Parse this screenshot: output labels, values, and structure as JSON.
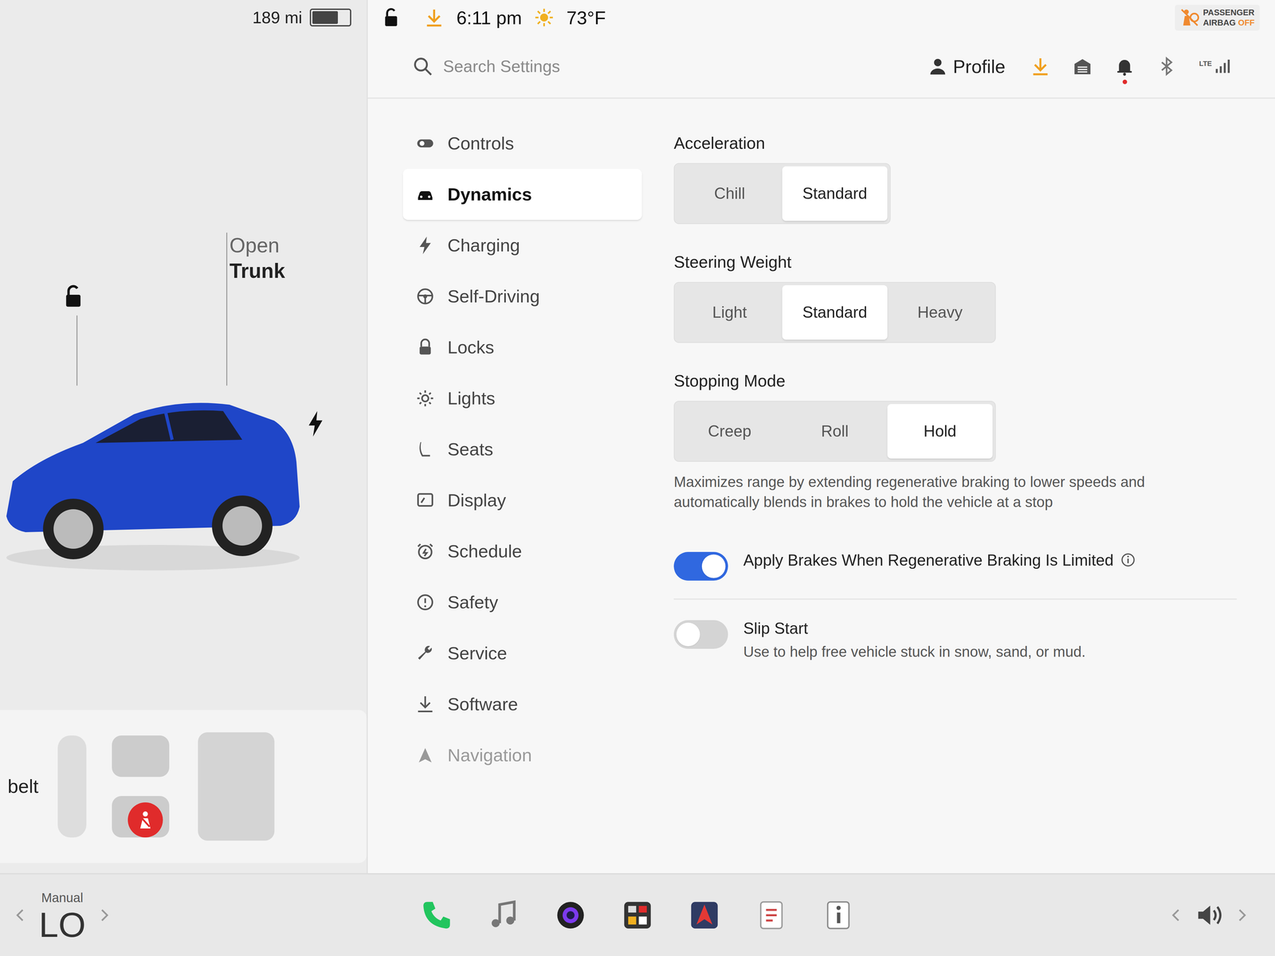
{
  "status_bar": {
    "range": "189 mi",
    "battery_level": 0.7,
    "time": "6:11 pm",
    "temperature": "73°F",
    "airbag": {
      "line1": "PASSENGER",
      "line2": "AIRBAG",
      "state": "OFF"
    }
  },
  "car_panel": {
    "trunk_line1": "Open",
    "trunk_line2": "Trunk",
    "seatbelt_label": "belt"
  },
  "header": {
    "search_placeholder": "Search Settings",
    "profile": "Profile",
    "network": "LTE"
  },
  "sidebar": {
    "items": [
      {
        "label": "Controls",
        "selected": false
      },
      {
        "label": "Dynamics",
        "selected": true
      },
      {
        "label": "Charging",
        "selected": false
      },
      {
        "label": "Self-Driving",
        "selected": false
      },
      {
        "label": "Locks",
        "selected": false
      },
      {
        "label": "Lights",
        "selected": false
      },
      {
        "label": "Seats",
        "selected": false
      },
      {
        "label": "Display",
        "selected": false
      },
      {
        "label": "Schedule",
        "selected": false
      },
      {
        "label": "Safety",
        "selected": false
      },
      {
        "label": "Service",
        "selected": false
      },
      {
        "label": "Software",
        "selected": false
      },
      {
        "label": "Navigation",
        "selected": false
      }
    ]
  },
  "settings": [
    {
      "title": "Acceleration",
      "options": [
        {
          "label": "Chill",
          "selected": false
        },
        {
          "label": "Standard",
          "selected": true
        }
      ],
      "description": ""
    },
    {
      "title": "Steering Weight",
      "options": [
        {
          "label": "Light",
          "selected": false
        },
        {
          "label": "Standard",
          "selected": true
        },
        {
          "label": "Heavy",
          "selected": false
        }
      ],
      "description": ""
    },
    {
      "title": "Stopping Mode",
      "options": [
        {
          "label": "Creep",
          "selected": false
        },
        {
          "label": "Roll",
          "selected": false
        },
        {
          "label": "Hold",
          "selected": true
        }
      ],
      "description": "Maximizes range by extending regenerative braking to lower speeds and automatically blends in brakes to hold the vehicle at a stop"
    }
  ],
  "toggles": [
    {
      "label": "Apply Brakes When Regenerative Braking Is Limited",
      "description": "",
      "on": true,
      "info": true
    },
    {
      "label": "Slip Start",
      "description": "Use to help free vehicle stuck in snow, sand, or mud.",
      "on": false,
      "info": false
    }
  ],
  "bottom_bar": {
    "climate_mode": "Manual",
    "temperature": "LO"
  }
}
